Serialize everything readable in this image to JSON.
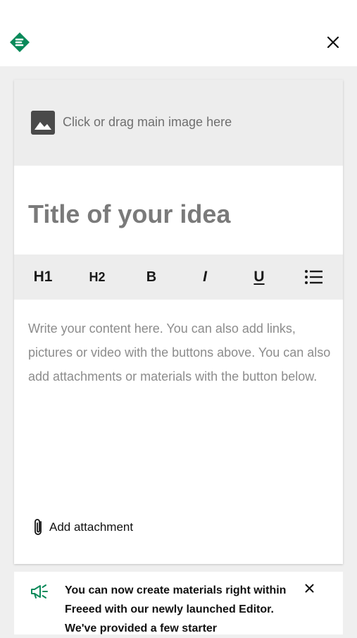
{
  "header": {
    "logo_icon": "freeed-logo-icon",
    "close_icon": "close-icon",
    "brand_color": "#0a8a5a"
  },
  "editor": {
    "image_drop_label": "Click or drag main image here",
    "image_icon": "image-icon",
    "title_placeholder": "Title of your idea",
    "toolbar": {
      "h1": "H1",
      "h2": "H2",
      "bold": "B",
      "italic": "I",
      "underline": "U",
      "list_icon": "bulleted-list-icon"
    },
    "content_placeholder": "Write your content here. You can also add links, pictures or video with the buttons above. You can also add attachments or materials with the button below.",
    "attachment_label": "Add attachment",
    "attachment_icon": "paperclip-icon"
  },
  "notice": {
    "icon": "megaphone-icon",
    "text": "You can now create materials right within Freeed with our newly launched Editor. We've provided a few starter",
    "close_icon": "close-icon",
    "accent_color": "#0a8a5a"
  }
}
